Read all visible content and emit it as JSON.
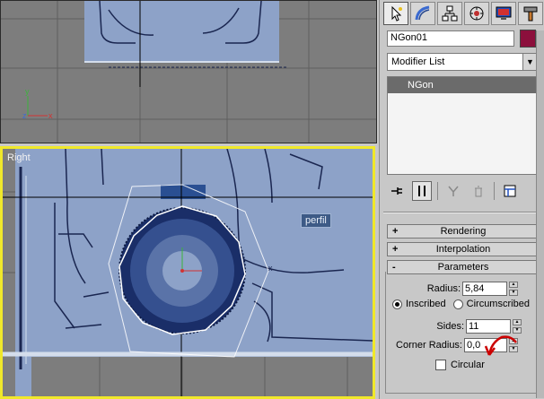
{
  "viewports": {
    "right": {
      "label": "Right"
    }
  },
  "scene": {
    "annotation_label": "perfil"
  },
  "panel": {
    "tabs": [
      {
        "name": "create",
        "icon": "create-cursor-icon",
        "active": true
      },
      {
        "name": "modify",
        "icon": "modify-bend-icon",
        "active": false
      },
      {
        "name": "hierarchy",
        "icon": "hierarchy-icon",
        "active": false
      },
      {
        "name": "motion",
        "icon": "motion-icon",
        "active": false
      },
      {
        "name": "display",
        "icon": "display-monitor-icon",
        "active": false
      },
      {
        "name": "utilities",
        "icon": "utilities-hammer-icon",
        "active": false
      }
    ],
    "object_name": "NGon01",
    "object_color": "#8c0f3c",
    "modifier_list_label": "Modifier List",
    "stack_items": [
      "NGon"
    ],
    "rollouts": {
      "rendering": {
        "sign": "+",
        "label": "Rendering"
      },
      "interpolation": {
        "sign": "+",
        "label": "Interpolation"
      },
      "parameters": {
        "sign": "-",
        "label": "Parameters"
      }
    },
    "parameters": {
      "radius_label": "Radius:",
      "radius_value": "5,84",
      "inscribed_label": "Inscribed",
      "circumscribed_label": "Circumscribed",
      "sides_label": "Sides:",
      "sides_value": "11",
      "corner_radius_label": "Corner Radius:",
      "corner_radius_value": "0,0",
      "circular_label": "Circular"
    }
  },
  "colors": {
    "active_viewport_border": "#f0e82a",
    "viewport_bg": "#7d7d7d",
    "blueprint": "#8da2c8",
    "annotation_arrow": "#cc0000"
  }
}
